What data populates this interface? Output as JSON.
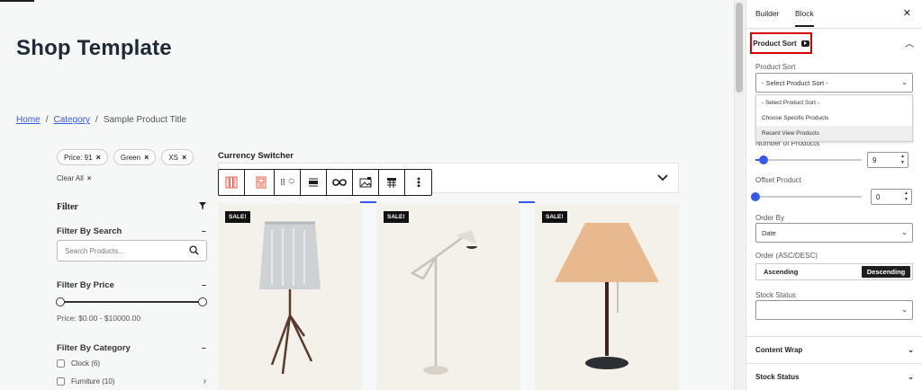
{
  "page": {
    "title": "Shop Template",
    "breadcrumb": {
      "home": "Home",
      "category": "Category",
      "current": "Sample Product Title",
      "separator": "/"
    }
  },
  "filters": {
    "chips": [
      "Price: 91",
      "Green",
      "XS"
    ],
    "chip_remove": "×",
    "clear_all": "Clear All",
    "heading": "Filter",
    "search": {
      "title": "Filter By Search",
      "placeholder": "Search Products..."
    },
    "price": {
      "title": "Filter By Price",
      "text": "Price: $0.00 - $10000.00",
      "min_fraction": 0,
      "max_fraction": 1
    },
    "category": {
      "title": "Filter By Category",
      "items": [
        "Clock (6)",
        "Furniture (10)"
      ]
    }
  },
  "main": {
    "currency_switcher": "Currency Switcher",
    "sale_badge": "SALE!"
  },
  "sidebar": {
    "tabs": [
      "Builder",
      "Block"
    ],
    "active_tab": "Block",
    "product_sort_panel": "Product Sort",
    "product_sort_label": "Product Sort",
    "product_sort_value": "- Select Product Sort -",
    "options": [
      "- Select Product Sort -",
      "Choose Specific Products",
      "Recent View Products"
    ],
    "number_label": "Number of Products",
    "number_value": "9",
    "number_fraction": 0.08,
    "offset_label": "Offset Product",
    "offset_value": "0",
    "offset_fraction": 0,
    "order_by_label": "Order By",
    "order_by_value": "Date",
    "order_label": "Order (ASC/DESC)",
    "asc": "Ascending",
    "desc": "Descending",
    "stock_label": "Stock Status",
    "stock_value": "",
    "accordions": [
      "Content Wrap",
      "Stock Status"
    ]
  },
  "colors": {
    "accent": "#3858e9",
    "highlight_border": "#d80000",
    "card_bg": "#f4f0ea"
  }
}
